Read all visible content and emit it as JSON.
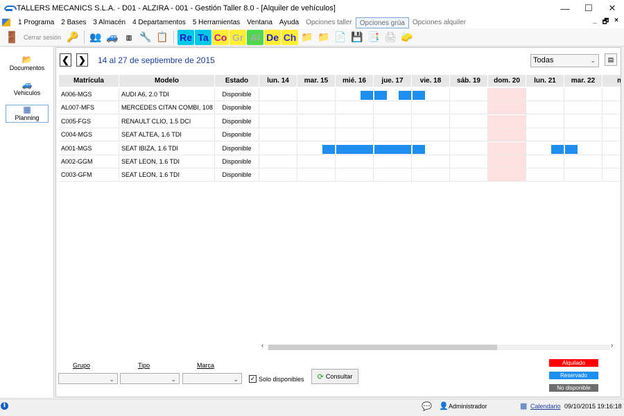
{
  "window": {
    "title": "TALLERS MECANICS S.L.A. - D01 - ALZIRA - 001 - Gestión Taller 8.0 - [Alquiler de vehículos]",
    "minimize": "—",
    "maximize": "☐",
    "close": "✕"
  },
  "menu": {
    "items": [
      "1 Programa",
      "2 Bases",
      "3 Almacén",
      "4 Departamentos",
      "5 Herramientas",
      "Ventana",
      "Ayuda",
      "Opciones taller",
      "Opciones grúa",
      "Opciones alquiler"
    ],
    "mdi_min": "_",
    "mdi_restore": "🗗",
    "mdi_close": "×"
  },
  "toolbar": {
    "cerrar_sesion": "Cerrar sesión",
    "glyphs": [
      {
        "label": "Re",
        "bg": "#00c8e6",
        "fg": "#1a1acc"
      },
      {
        "label": "Ta",
        "bg": "#00c8e6",
        "fg": "#1a1acc"
      },
      {
        "label": "Co",
        "bg": "#ffee33",
        "fg": "#cc1a8a"
      },
      {
        "label": "Gr",
        "bg": "#ffee33",
        "fg": "#b3b3b3"
      },
      {
        "label": "Al",
        "bg": "#4dd84d",
        "fg": "#aaaaaa"
      },
      {
        "label": "De",
        "bg": "#ffee33",
        "fg": "#2222cc"
      },
      {
        "label": "Ch",
        "bg": "#ffee33",
        "fg": "#3333cc"
      }
    ]
  },
  "sidebar": {
    "items": [
      {
        "label": "Documentos",
        "icon": "📂"
      },
      {
        "label": "Vehiculos",
        "icon": "🚙"
      },
      {
        "label": "Planning",
        "icon": "▦"
      }
    ]
  },
  "planning": {
    "prev": "❮",
    "next": "❯",
    "range_label": "14 al 27 de septiembre de 2015",
    "filter_value": "Todas",
    "columns": {
      "matricula": "Matrícula",
      "modelo": "Modelo",
      "estado": "Estado"
    },
    "days": [
      "lun. 14",
      "mar. 15",
      "mié. 16",
      "jue. 17",
      "vie. 18",
      "sáb. 19",
      "dom. 20",
      "lun. 21",
      "mar. 22",
      "mi"
    ],
    "sunday_index": 6,
    "rows": [
      {
        "matricula": "A006-MGS",
        "modelo": "AUDI A6, 2.0 TDI",
        "estado": "Disponible",
        "bookings": [
          [
            2.66,
            2.98
          ],
          [
            3.02,
            3.34
          ],
          [
            3.66,
            3.98
          ],
          [
            4.02,
            4.34
          ]
        ]
      },
      {
        "matricula": "AL007-MFS",
        "modelo": "MERCEDES CITAN COMBI, 108 Cdi",
        "estado": "Disponible",
        "bookings": []
      },
      {
        "matricula": "C005-FGS",
        "modelo": "RENAULT CLIO, 1.5 DCI",
        "estado": "Disponible",
        "bookings": []
      },
      {
        "matricula": "C004-MGS",
        "modelo": "SEAT ALTEA, 1.6 TDI",
        "estado": "Disponible",
        "bookings": []
      },
      {
        "matricula": "A001-MGS",
        "modelo": "SEAT IBIZA, 1.6 TDI",
        "estado": "Disponible",
        "bookings": [
          [
            1.66,
            1.98
          ],
          [
            2.02,
            2.98
          ],
          [
            3.02,
            3.98
          ],
          [
            4.02,
            4.34
          ],
          [
            7.66,
            7.98
          ],
          [
            8.02,
            8.34
          ]
        ]
      },
      {
        "matricula": "A002-GGM",
        "modelo": "SEAT LEON, 1.6 TDI",
        "estado": "Disponible",
        "bookings": []
      },
      {
        "matricula": "C003-GFM",
        "modelo": "SEAT LEON, 1.6 TDI",
        "estado": "Disponible",
        "bookings": []
      }
    ],
    "scroll_left": "‹",
    "scroll_right": "›"
  },
  "filters": {
    "grupo_label": "Grupo",
    "tipo_label": "Tipo",
    "marca_label": "Marca",
    "solo_disponibles_label": "Solo disponibles",
    "solo_disponibles_checked": "✓",
    "consultar_label": "Consultar",
    "legend": [
      {
        "label": "Alquilado",
        "color": "#ff0000"
      },
      {
        "label": "Reservado",
        "color": "#1e8ff0"
      },
      {
        "label": "No disponible",
        "color": "#6e6e6e"
      }
    ]
  },
  "status": {
    "info": "i",
    "user": "Administrador",
    "calendar_link": "Calendario",
    "datetime": "09/10/2015 19:16:18"
  }
}
